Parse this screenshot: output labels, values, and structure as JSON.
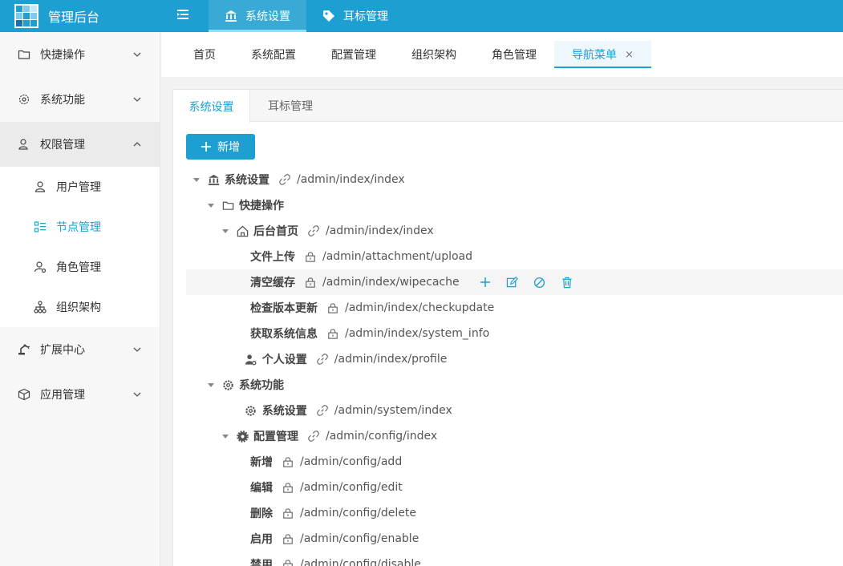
{
  "app": {
    "title": "管理后台"
  },
  "topnav": [
    {
      "label": "系统设置",
      "icon": "bank-icon",
      "active": true
    },
    {
      "label": "耳标管理",
      "icon": "tag-icon",
      "active": false
    }
  ],
  "sidebar": {
    "items": [
      {
        "label": "快捷操作",
        "icon": "folder-icon"
      },
      {
        "label": "系统功能",
        "icon": "gear-icon"
      },
      {
        "label": "权限管理",
        "icon": "user-icon"
      },
      {
        "label": "扩展中心",
        "icon": "robot-arm-icon"
      },
      {
        "label": "应用管理",
        "icon": "box-icon"
      }
    ],
    "sub_items": [
      {
        "label": "用户管理",
        "icon": "user-icon"
      },
      {
        "label": "节点管理",
        "icon": "list-icon",
        "active": true
      },
      {
        "label": "角色管理",
        "icon": "user-gear-icon"
      },
      {
        "label": "组织架构",
        "icon": "org-chart-icon"
      }
    ]
  },
  "pagetabs": [
    {
      "label": "首页"
    },
    {
      "label": "系统配置"
    },
    {
      "label": "配置管理"
    },
    {
      "label": "组织架构"
    },
    {
      "label": "角色管理"
    },
    {
      "label": "导航菜单",
      "active": true,
      "close": "×"
    }
  ],
  "subtabs": [
    {
      "label": "系统设置",
      "active": true
    },
    {
      "label": "耳标管理"
    }
  ],
  "add_button": {
    "label": "新增"
  },
  "tree": [
    {
      "title": "系统设置",
      "path": "/admin/index/index",
      "icon": "bank-icon"
    },
    {
      "title": "快捷操作",
      "path": "",
      "icon": "folder-icon"
    },
    {
      "title": "后台首页",
      "path": "/admin/index/index",
      "icon": "home-icon"
    },
    {
      "title": "文件上传",
      "path": "/admin/attachment/upload",
      "icon": ""
    },
    {
      "title": "清空缓存",
      "path": "/admin/index/wipecache",
      "icon": ""
    },
    {
      "title": "检查版本更新",
      "path": "/admin/index/checkupdate",
      "icon": ""
    },
    {
      "title": "获取系统信息",
      "path": "/admin/index/system_info",
      "icon": ""
    },
    {
      "title": "个人设置",
      "path": "/admin/index/profile",
      "icon": "user-gear-icon"
    },
    {
      "title": "系统功能",
      "path": "",
      "icon": "gear-icon"
    },
    {
      "title": "系统设置",
      "path": "/admin/system/index",
      "icon": "gear-icon"
    },
    {
      "title": "配置管理",
      "path": "/admin/config/index",
      "icon": "cog-fill-icon"
    },
    {
      "title": "新增",
      "path": "/admin/config/add",
      "icon": ""
    },
    {
      "title": "编辑",
      "path": "/admin/config/edit",
      "icon": ""
    },
    {
      "title": "删除",
      "path": "/admin/config/delete",
      "icon": ""
    },
    {
      "title": "启用",
      "path": "/admin/config/enable",
      "icon": ""
    },
    {
      "title": "禁用",
      "path": "/admin/config/disable",
      "icon": ""
    }
  ],
  "colors": {
    "primary": "#1e9fd1",
    "sidebar_bg": "#f7f7f7"
  }
}
